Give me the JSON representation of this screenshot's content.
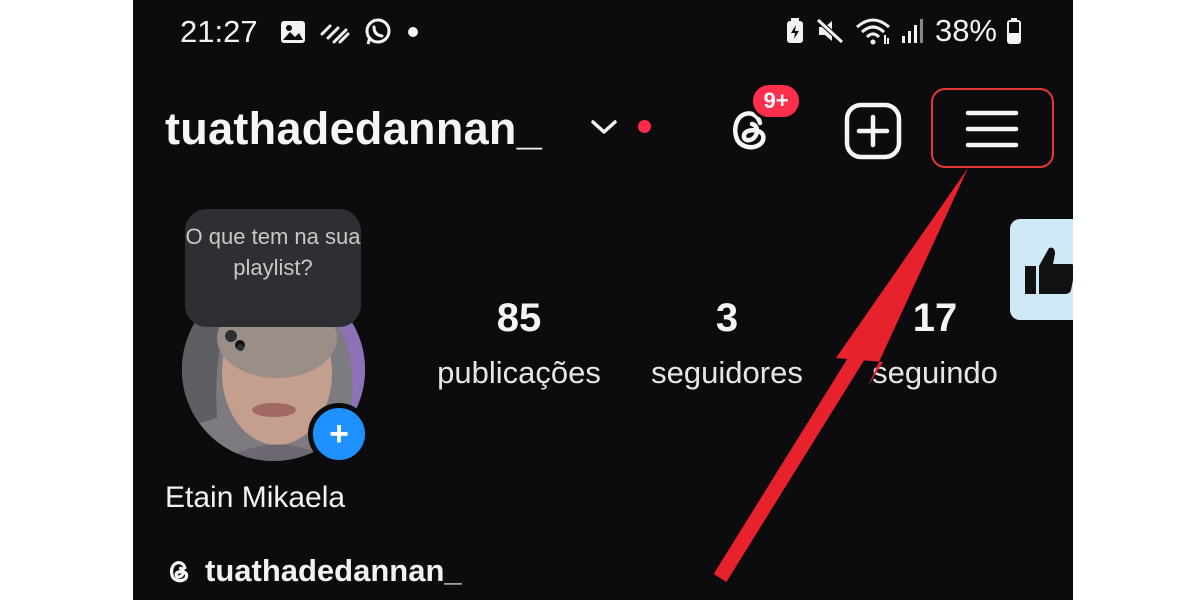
{
  "status_bar": {
    "time": "21:27",
    "battery_percent": "38%",
    "icons_left": [
      "image-icon",
      "signal-activity-icon",
      "whatsapp-icon",
      "dot-icon"
    ],
    "icons_right": [
      "battery-saver-icon",
      "mute-icon",
      "wifi-icon",
      "cell-signal-icon",
      "battery-icon"
    ]
  },
  "header": {
    "username": "tuathadedannan_",
    "threads_badge": "9+",
    "accent_red": "#ff2a4a"
  },
  "note": {
    "text": "O que tem na sua playlist?"
  },
  "profile": {
    "display_name": "Etain Mikaela",
    "threads_handle": "tuathadedannan_"
  },
  "stats": [
    {
      "number": "85",
      "label": "publicações"
    },
    {
      "number": "3",
      "label": "seguidores"
    },
    {
      "number": "17",
      "label": "seguindo"
    }
  ],
  "colors": {
    "background": "#0c0c0f",
    "add_story": "#1e90ff",
    "annotation": "#e53935",
    "like_tab": "#cfe9f6"
  }
}
